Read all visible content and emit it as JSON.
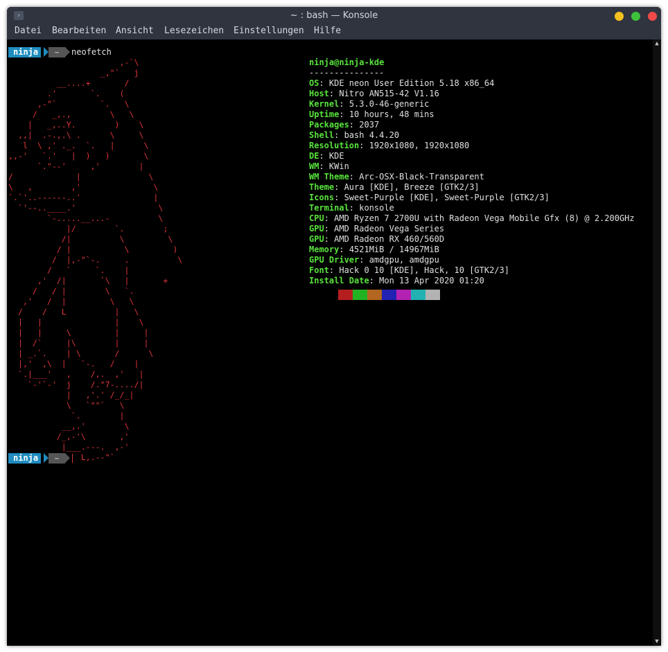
{
  "window": {
    "title": "~ : bash — Konsole",
    "buttons": [
      {
        "name": "minimize",
        "color": "#f5c11f"
      },
      {
        "name": "maximize",
        "color": "#3ec23c"
      },
      {
        "name": "close",
        "color": "#ef4a4a"
      }
    ]
  },
  "menu": [
    "Datei",
    "Bearbeiten",
    "Ansicht",
    "Lesezeichen",
    "Einstellungen",
    "Hilfe"
  ],
  "prompt": {
    "user": "ninja",
    "dir": "~",
    "command": "neofetch"
  },
  "ascii_art": "                       ,-`\\\n                   _,\"`   j\n          __....+       /\n        .'       `.    (\n      ,-\"`         `.   \\\n     /   _,.,        \\   \\\n    |   _,..Y.        )    \\\n  ,,|  .-.,.\\ .      \\     \\\n   l  \\ ,' ._.  `.   |      \\\n,,-'   `.'   |  )   )       \\\n      `.\"--'     ,'        |\n/             |              \\\n\\   ,        ,'               \\\n`.`'..------..'               |\n  `'--..____.'                 \\\n        `-.....__...-          \\\n            |/        `.        ;\n           /|          \\         \\\n          / |           \\         )\n         /  |,-\"`-.     .          \\\n        /   `     `.    |\n      ,'  /|       `\\   |       +\n     /   / |        \\   `.\n   ,'   /  |         \\   \\\n  /    /   L          |   \\\n  |   |               |    \\\n  |   |     \\         |     |\n  |  /`     |\\        |     |\n  | _.`.    | \\       /      \\\n  |,'  ,\\  |   `-.   /    |\n  `.|___'   ,    /,.  ,'   |\n    `-'`-'  j    /.\"7-..../|\n            |   ,'.' /_/_|\n            \\   `\"\"`   \\\n             `.        |\n           __,.'        \\\n          /_,-'\\       ,'\n           |___.---.  ,-'\n               L,.--\"`",
  "info": {
    "header": "ninja@ninja-kde",
    "separator": "---------------",
    "rows": [
      {
        "key": "OS",
        "value": "KDE neon User Edition 5.18 x86_64"
      },
      {
        "key": "Host",
        "value": "Nitro AN515-42 V1.16"
      },
      {
        "key": "Kernel",
        "value": "5.3.0-46-generic"
      },
      {
        "key": "Uptime",
        "value": "10 hours, 48 mins"
      },
      {
        "key": "Packages",
        "value": "2037"
      },
      {
        "key": "Shell",
        "value": "bash 4.4.20"
      },
      {
        "key": "Resolution",
        "value": "1920x1080, 1920x1080"
      },
      {
        "key": "DE",
        "value": "KDE"
      },
      {
        "key": "WM",
        "value": "KWin"
      },
      {
        "key": "WM Theme",
        "value": "Arc-OSX-Black-Transparent"
      },
      {
        "key": "Theme",
        "value": "Aura [KDE], Breeze [GTK2/3]"
      },
      {
        "key": "Icons",
        "value": "Sweet-Purple [KDE], Sweet-Purple [GTK2/3]"
      },
      {
        "key": "Terminal",
        "value": "konsole"
      },
      {
        "key": "CPU",
        "value": "AMD Ryzen 7 2700U with Radeon Vega Mobile Gfx (8) @ 2.200GHz"
      },
      {
        "key": "GPU",
        "value": "AMD Radeon Vega Series"
      },
      {
        "key": "GPU",
        "value": "AMD Radeon RX 460/560D"
      },
      {
        "key": "Memory",
        "value": "4521MiB / 14967MiB"
      },
      {
        "key": "GPU Driver",
        "value": "amdgpu, amdgpu"
      },
      {
        "key": "Font",
        "value": "Hack 0 10 [KDE], Hack, 10 [GTK2/3]"
      },
      {
        "key": "Install Date",
        "value": "Mon 13 Apr 2020 01:20"
      }
    ]
  },
  "palette": [
    "#000000",
    "#b51e1e",
    "#22b322",
    "#b2661f",
    "#2222b3",
    "#b322b3",
    "#22b2b2",
    "#b3b3b3"
  ],
  "colors": {
    "accent_green": "#58e33c",
    "ascii_red": "#e0353a",
    "prompt_blue": "#1f8cbf"
  }
}
